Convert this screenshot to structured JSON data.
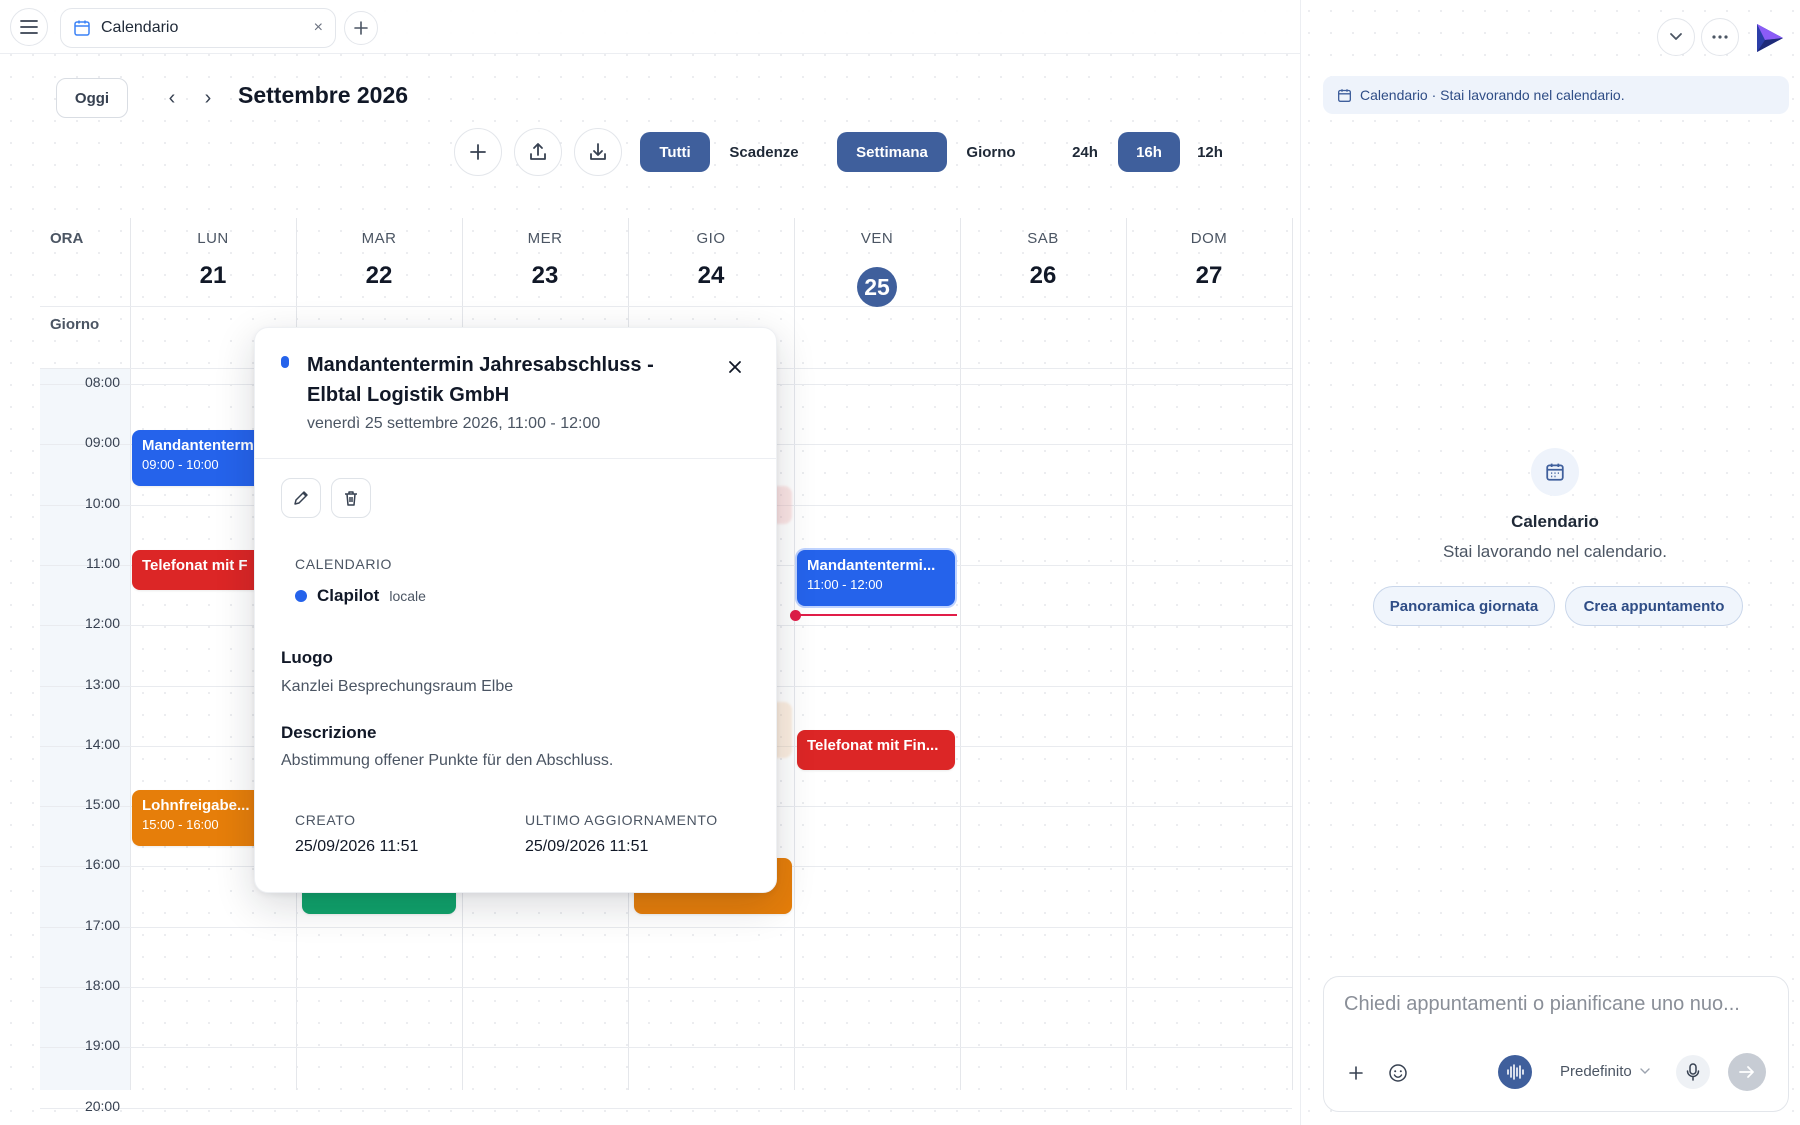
{
  "tab": {
    "label": "Calendario",
    "close": "×"
  },
  "header": {
    "today": "Oggi",
    "month": "Settembre 2026",
    "prev": "‹",
    "next": "›"
  },
  "toolbar": {
    "filter_all": "Tutti",
    "filter_deadlines": "Scadenze",
    "view_week": "Settimana",
    "view_day": "Giorno",
    "range_24": "24h",
    "range_16": "16h",
    "range_12": "12h"
  },
  "grid": {
    "ora": "ORA",
    "giorno": "Giorno",
    "days": [
      {
        "name": "LUN",
        "num": "21"
      },
      {
        "name": "MAR",
        "num": "22"
      },
      {
        "name": "MER",
        "num": "23"
      },
      {
        "name": "GIO",
        "num": "24"
      },
      {
        "name": "VEN",
        "num": "25"
      },
      {
        "name": "SAB",
        "num": "26"
      },
      {
        "name": "DOM",
        "num": "27"
      }
    ],
    "hours": [
      "08:00",
      "09:00",
      "10:00",
      "11:00",
      "12:00",
      "13:00",
      "14:00",
      "15:00",
      "16:00",
      "17:00",
      "18:00",
      "19:00",
      "20:00"
    ]
  },
  "events": {
    "lun_mandanten": {
      "title": "Mandantenterm",
      "time": "09:00 - 10:00"
    },
    "lun_telefonat": {
      "title": "Telefonat mit F"
    },
    "lun_lohn": {
      "title": "Lohnfreigabe...",
      "time": "15:00 - 16:00"
    },
    "ven_mandanten": {
      "title": "Mandantentermi...",
      "time": "11:00 - 12:00"
    },
    "ven_telefonat": {
      "title": "Telefonat mit Fin..."
    }
  },
  "popover": {
    "title": "Mandantentermin Jahresabschluss - Elbtal Logistik GmbH",
    "date": "venerdì 25 settembre 2026, 11:00 - 12:00",
    "calendar_caption": "CALENDARIO",
    "calendar_name": "Clapilot",
    "calendar_type": "locale",
    "location_label": "Luogo",
    "location": "Kanzlei Besprechungsraum Elbe",
    "description_label": "Descrizione",
    "description": "Abstimmung offener Punkte für den Abschluss.",
    "created_label": "CREATO",
    "created": "25/09/2026 11:51",
    "updated_label": "ULTIMO AGGIORNAMENTO",
    "updated": "25/09/2026 11:51"
  },
  "right_panel": {
    "context_chip": "Calendario · Stai lavorando nel calendario.",
    "title": "Calendario",
    "subtitle": "Stai lavorando nel calendario.",
    "pill_overview": "Panoramica giornata",
    "pill_create": "Crea appuntamento",
    "composer_placeholder": "Chiedi appuntamenti o pianificane uno nuo...",
    "model": "Predefinito"
  },
  "colors": {
    "accent": "#3f5f9c",
    "event_blue": "#2563eb",
    "event_red": "#dc2626",
    "event_orange": "#e67e0a",
    "event_green": "#10a36b",
    "now_line": "#e11d48"
  }
}
